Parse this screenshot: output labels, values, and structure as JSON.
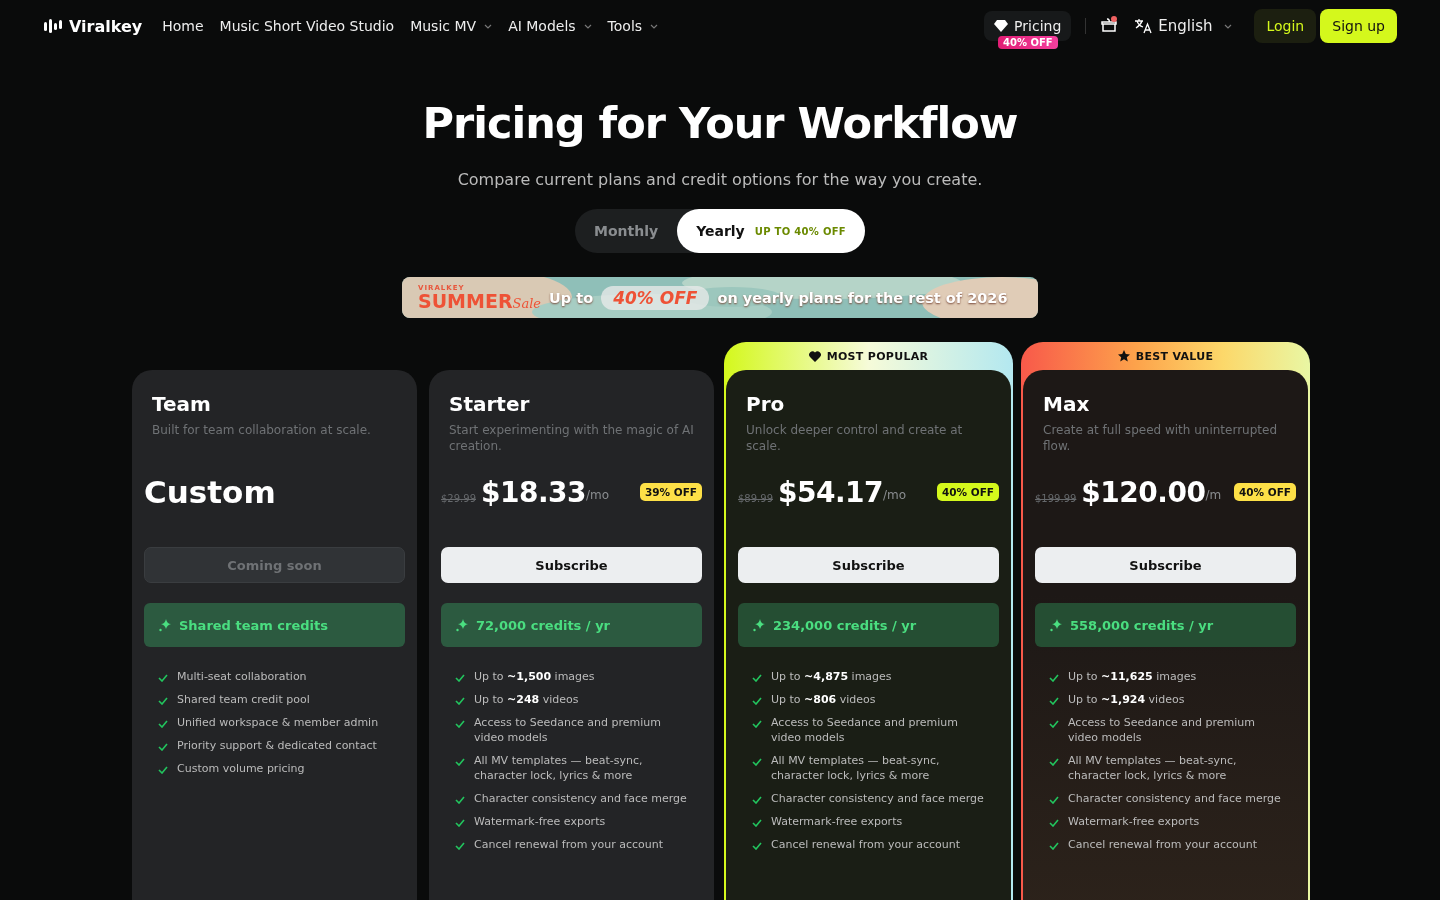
{
  "nav": {
    "logo": "Viralkey",
    "links": [
      {
        "label": "Home",
        "dropdown": false
      },
      {
        "label": "Music Short Video Studio",
        "dropdown": false
      },
      {
        "label": "Music MV",
        "dropdown": true
      },
      {
        "label": "AI Models",
        "dropdown": true
      },
      {
        "label": "Tools",
        "dropdown": true
      }
    ],
    "pricing": {
      "label": "Pricing",
      "badge": "40% OFF"
    },
    "notification": true,
    "language": "English",
    "login": "Login",
    "signup": "Sign up"
  },
  "hero": {
    "title": "Pricing for Your Workflow",
    "subtitle": "Compare current plans and credit options for the way you create."
  },
  "billing_toggle": [
    {
      "label": "Monthly",
      "selected": false
    },
    {
      "label": "Yearly",
      "selected": true,
      "badge": "UP TO 40% OFF"
    }
  ],
  "banner": {
    "brand": "VIRALKEY",
    "title": "SUMMER",
    "script": "Sale",
    "lead": "Up to",
    "highlight": "40% OFF",
    "tail": "on yearly plans for the rest of 2026"
  },
  "plans": [
    {
      "name": "Team",
      "tagline": "Built for team collaboration at scale.",
      "kind": "custom",
      "price": "Custom",
      "button": {
        "label": "Coming soon",
        "disabled": true
      },
      "credits": "Shared team credits",
      "features": [
        "Multi-seat collaboration",
        "Shared team credit pool",
        "Unified workspace & member admin",
        "Priority support & dedicated contact",
        "Custom volume pricing"
      ]
    },
    {
      "name": "Starter",
      "tagline": "Start experimenting with the magic of AI creation.",
      "kind": "paid",
      "old_price": "$29.99",
      "price": "$18.33",
      "per": "/mo",
      "discount": {
        "label": "39% OFF",
        "color": "#fde047"
      },
      "button": {
        "label": "Subscribe",
        "disabled": false
      },
      "credits": "72,000 credits / yr",
      "features": [
        "Up to **~1,500** images",
        "Up to **~248** videos",
        "Access to Seedance and premium video models",
        "All MV templates — beat-sync, character lock, lyrics & more",
        "Character consistency and face merge",
        "Watermark-free exports",
        "Cancel renewal from your account"
      ]
    },
    {
      "name": "Pro",
      "tagline": "Unlock deeper control and create at scale.",
      "kind": "paid",
      "ribbon": {
        "label": "MOST POPULAR",
        "kind": "popular"
      },
      "old_price": "$89.99",
      "price": "$54.17",
      "per": "/mo",
      "discount": {
        "label": "40% OFF",
        "color": "#d4f81c"
      },
      "button": {
        "label": "Subscribe",
        "disabled": false
      },
      "credits": "234,000 credits / yr",
      "features": [
        "Up to **~4,875** images",
        "Up to **~806** videos",
        "Access to Seedance and premium video models",
        "All MV templates — beat-sync, character lock, lyrics & more",
        "Character consistency and face merge",
        "Watermark-free exports",
        "Cancel renewal from your account"
      ]
    },
    {
      "name": "Max",
      "tagline": "Create at full speed with uninterrupted flow.",
      "kind": "paid",
      "ribbon": {
        "label": "BEST VALUE",
        "kind": "value"
      },
      "old_price": "$199.99",
      "price": "$120.00",
      "per": "/m",
      "discount": {
        "label": "40% OFF",
        "color": "#fde047"
      },
      "button": {
        "label": "Subscribe",
        "disabled": false
      },
      "credits": "558,000 credits / yr",
      "features": [
        "Up to **~11,625** images",
        "Up to **~1,924** videos",
        "Access to Seedance and premium video models",
        "All MV templates — beat-sync, character lock, lyrics & more",
        "Character consistency and face merge",
        "Watermark-free exports",
        "Cancel renewal from your account"
      ]
    }
  ]
}
